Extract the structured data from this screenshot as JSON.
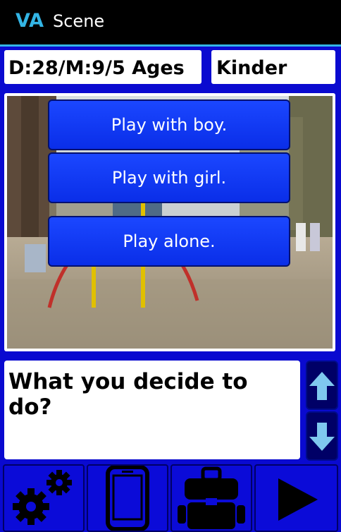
{
  "app": {
    "logo": "VA",
    "title": "Scene"
  },
  "info": {
    "date_label": "D:28/M:9/5 Ages",
    "level": "Kinder"
  },
  "scene": {
    "choices": [
      {
        "label": "Play with boy."
      },
      {
        "label": "Play with girl."
      },
      {
        "label": "Play alone."
      }
    ]
  },
  "question": {
    "text": "What you decide to do?"
  },
  "icons": {
    "scroll_up": "arrow-up-icon",
    "scroll_down": "arrow-down-icon",
    "settings": "gears-icon",
    "device": "phone-icon",
    "bag": "backpack-icon",
    "play": "play-icon"
  },
  "colors": {
    "accent": "#33b5e5",
    "panel": "#0a0ad0",
    "button": "#1b47ff"
  }
}
